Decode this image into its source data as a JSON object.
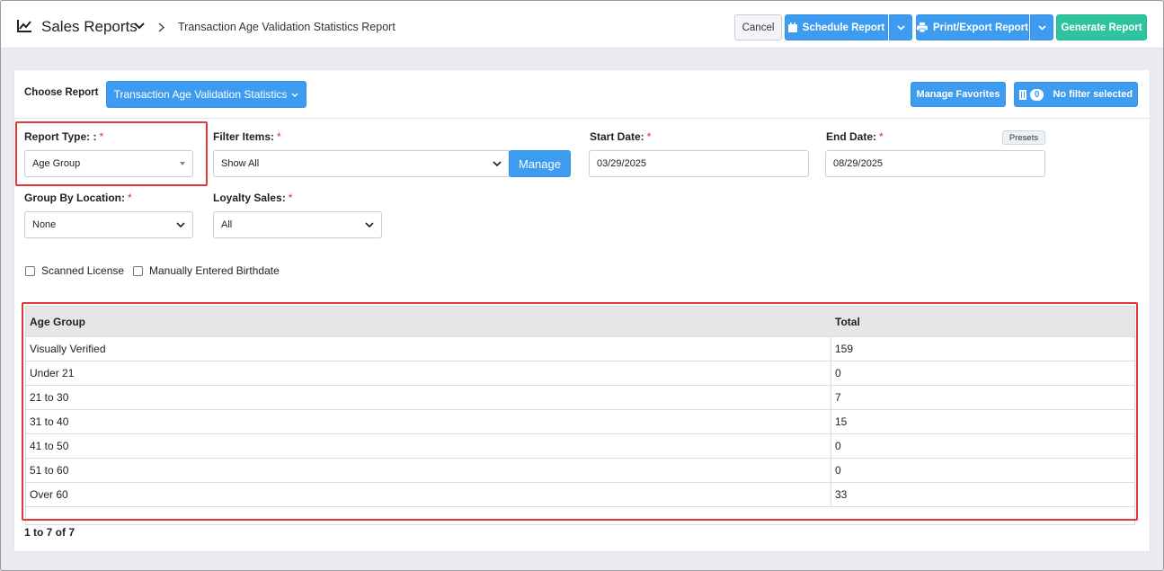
{
  "header": {
    "title": "Sales Reports",
    "breadcrumb": "Transaction Age Validation Statistics Report",
    "cancel_label": "Cancel",
    "schedule_label": "Schedule Report",
    "print_label": "Print/Export Report",
    "generate_label": "Generate Report"
  },
  "toolbar": {
    "choose_label": "Choose Report",
    "choose_value": "Transaction Age Validation Statistics",
    "favorites_label": "Manage Favorites",
    "filter_count": "0",
    "filter_label": "No filter selected"
  },
  "form": {
    "report_type_label": "Report Type: :",
    "report_type_value": "Age Group",
    "filter_items_label": "Filter Items:",
    "filter_items_value": "Show All",
    "manage_label": "Manage",
    "start_date_label": "Start Date:",
    "start_date_value": "03/29/2025",
    "end_date_label": "End Date:",
    "end_date_value": "08/29/2025",
    "presets_label": "Presets",
    "group_by_label": "Group By Location:",
    "group_by_value": "None",
    "loyalty_label": "Loyalty Sales:",
    "loyalty_value": "All",
    "required_mark": "*",
    "scanned_license_label": "Scanned License",
    "manual_birthdate_label": "Manually Entered Birthdate"
  },
  "table": {
    "columns": [
      "Age Group",
      "Total"
    ],
    "rows": [
      [
        "Visually Verified",
        "159"
      ],
      [
        "Under 21",
        "0"
      ],
      [
        "21 to 30",
        "7"
      ],
      [
        "31 to 40",
        "15"
      ],
      [
        "41 to 50",
        "0"
      ],
      [
        "51 to 60",
        "0"
      ],
      [
        "Over 60",
        "33"
      ]
    ],
    "pager": "1 to 7 of 7"
  },
  "colors": {
    "primary": "#3d9bf0",
    "success": "#2ec4a0",
    "highlight": "#e0373b",
    "required": "#e02c2c"
  }
}
